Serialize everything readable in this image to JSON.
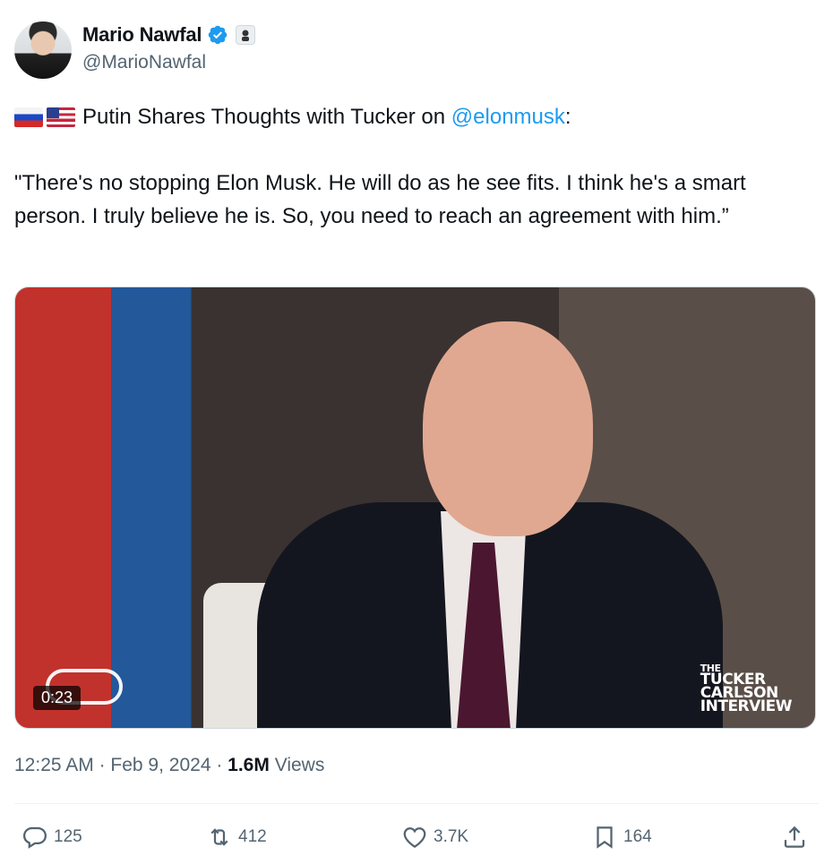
{
  "author": {
    "display_name": "Mario Nawfal",
    "handle": "@MarioNawfal",
    "verified": true,
    "verified_color": "#1d9bf0"
  },
  "tweet": {
    "flags": [
      "russia-flag",
      "usa-flag"
    ],
    "headline_prefix": "Putin Shares Thoughts with Tucker on ",
    "mention": "@elonmusk",
    "headline_suffix": ":",
    "quote": "\"There's no stopping Elon Musk. He will do as he see fits. I think he's a smart person. I truly believe he is. So, you need to reach an agreement with him.”"
  },
  "media": {
    "duration": "0:23",
    "watermark_lines": [
      "THE",
      "TUCKER",
      "CARLSON",
      "INTERVIEW"
    ]
  },
  "meta": {
    "time": "12:25 AM",
    "separator": " · ",
    "date": "Feb 9, 2024",
    "views_count": "1.6M",
    "views_label": " Views"
  },
  "actions": {
    "reply_count": "125",
    "retweet_count": "412",
    "like_count": "3.7K",
    "bookmark_count": "164"
  },
  "colors": {
    "text": "#0f1419",
    "secondary": "#536471",
    "link": "#1d9bf0"
  }
}
